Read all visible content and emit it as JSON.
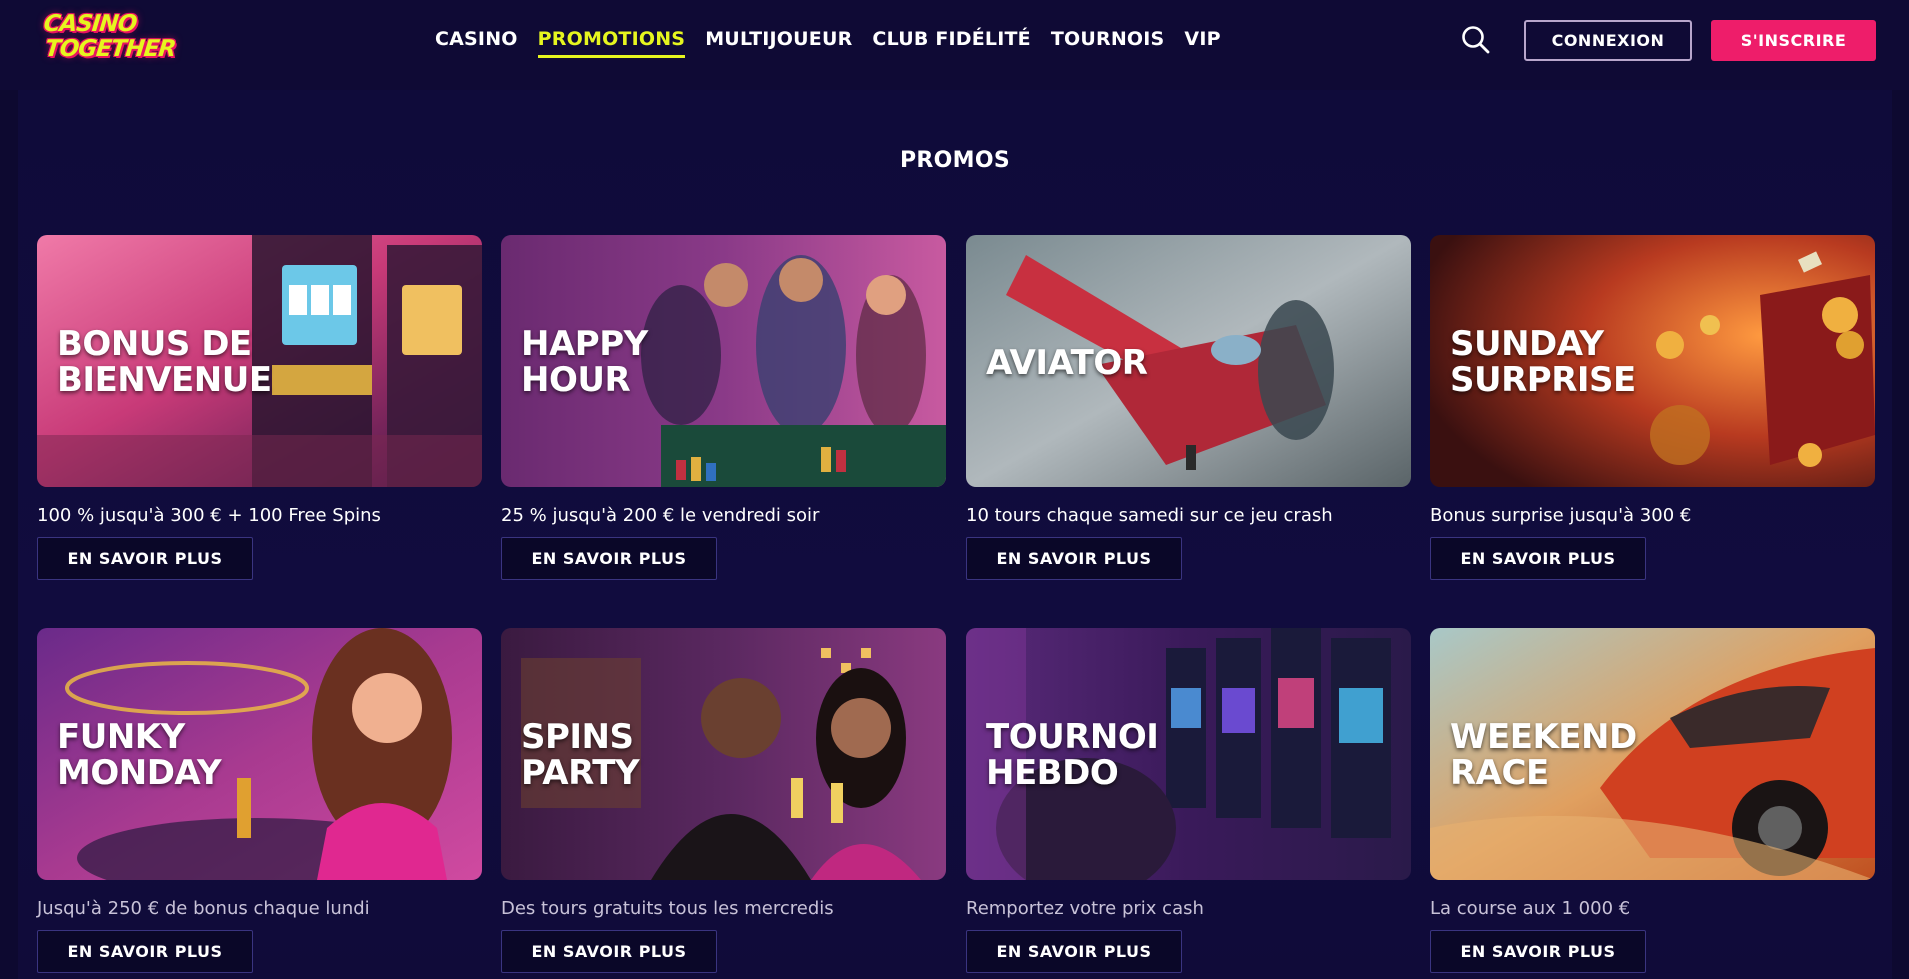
{
  "header": {
    "logo_line1": "CASINO",
    "logo_line2": "TOGETHER",
    "nav": [
      {
        "label": "CASINO",
        "active": false
      },
      {
        "label": "PROMOTIONS",
        "active": true
      },
      {
        "label": "MULTIJOUEUR",
        "active": false
      },
      {
        "label": "CLUB FIDÉLITÉ",
        "active": false
      },
      {
        "label": "TOURNOIS",
        "active": false
      },
      {
        "label": "VIP",
        "active": false
      }
    ],
    "search_icon": "search-icon",
    "login_label": "CONNEXION",
    "signup_label": "S'INSCRIRE"
  },
  "main": {
    "title": "PROMOS",
    "cards": [
      {
        "title_line1": "BONUS DE",
        "title_line2": "BIENVENUE",
        "description": "100 % jusqu'à 300 € + 100 Free Spins",
        "button": "EN SAVOIR PLUS"
      },
      {
        "title_line1": "HAPPY",
        "title_line2": "HOUR",
        "description": "25 % jusqu'à 200 € le vendredi soir",
        "button": "EN SAVOIR PLUS"
      },
      {
        "title_line1": "AVIATOR",
        "title_line2": "",
        "description": "10 tours chaque samedi sur ce jeu crash",
        "button": "EN SAVOIR PLUS"
      },
      {
        "title_line1": "SUNDAY",
        "title_line2": "SURPRISE",
        "description": "Bonus surprise jusqu'à 300 €",
        "button": "EN SAVOIR PLUS"
      },
      {
        "title_line1": "FUNKY",
        "title_line2": "MONDAY",
        "description": "Jusqu'à 250 € de bonus chaque lundi",
        "button": "EN SAVOIR PLUS"
      },
      {
        "title_line1": "SPINS",
        "title_line2": "PARTY",
        "description": "Des tours gratuits tous les mercredis",
        "button": "EN SAVOIR PLUS"
      },
      {
        "title_line1": "TOURNOI",
        "title_line2": "HEBDO",
        "description": "Remportez votre prix cash",
        "button": "EN SAVOIR PLUS"
      },
      {
        "title_line1": "WEEKEND",
        "title_line2": "RACE",
        "description": "La course aux 1 000 €",
        "button": "EN SAVOIR PLUS"
      }
    ]
  },
  "colors": {
    "accent_yellow": "#e6f51f",
    "accent_pink": "#ee1d6a",
    "background": "#0d0930"
  }
}
